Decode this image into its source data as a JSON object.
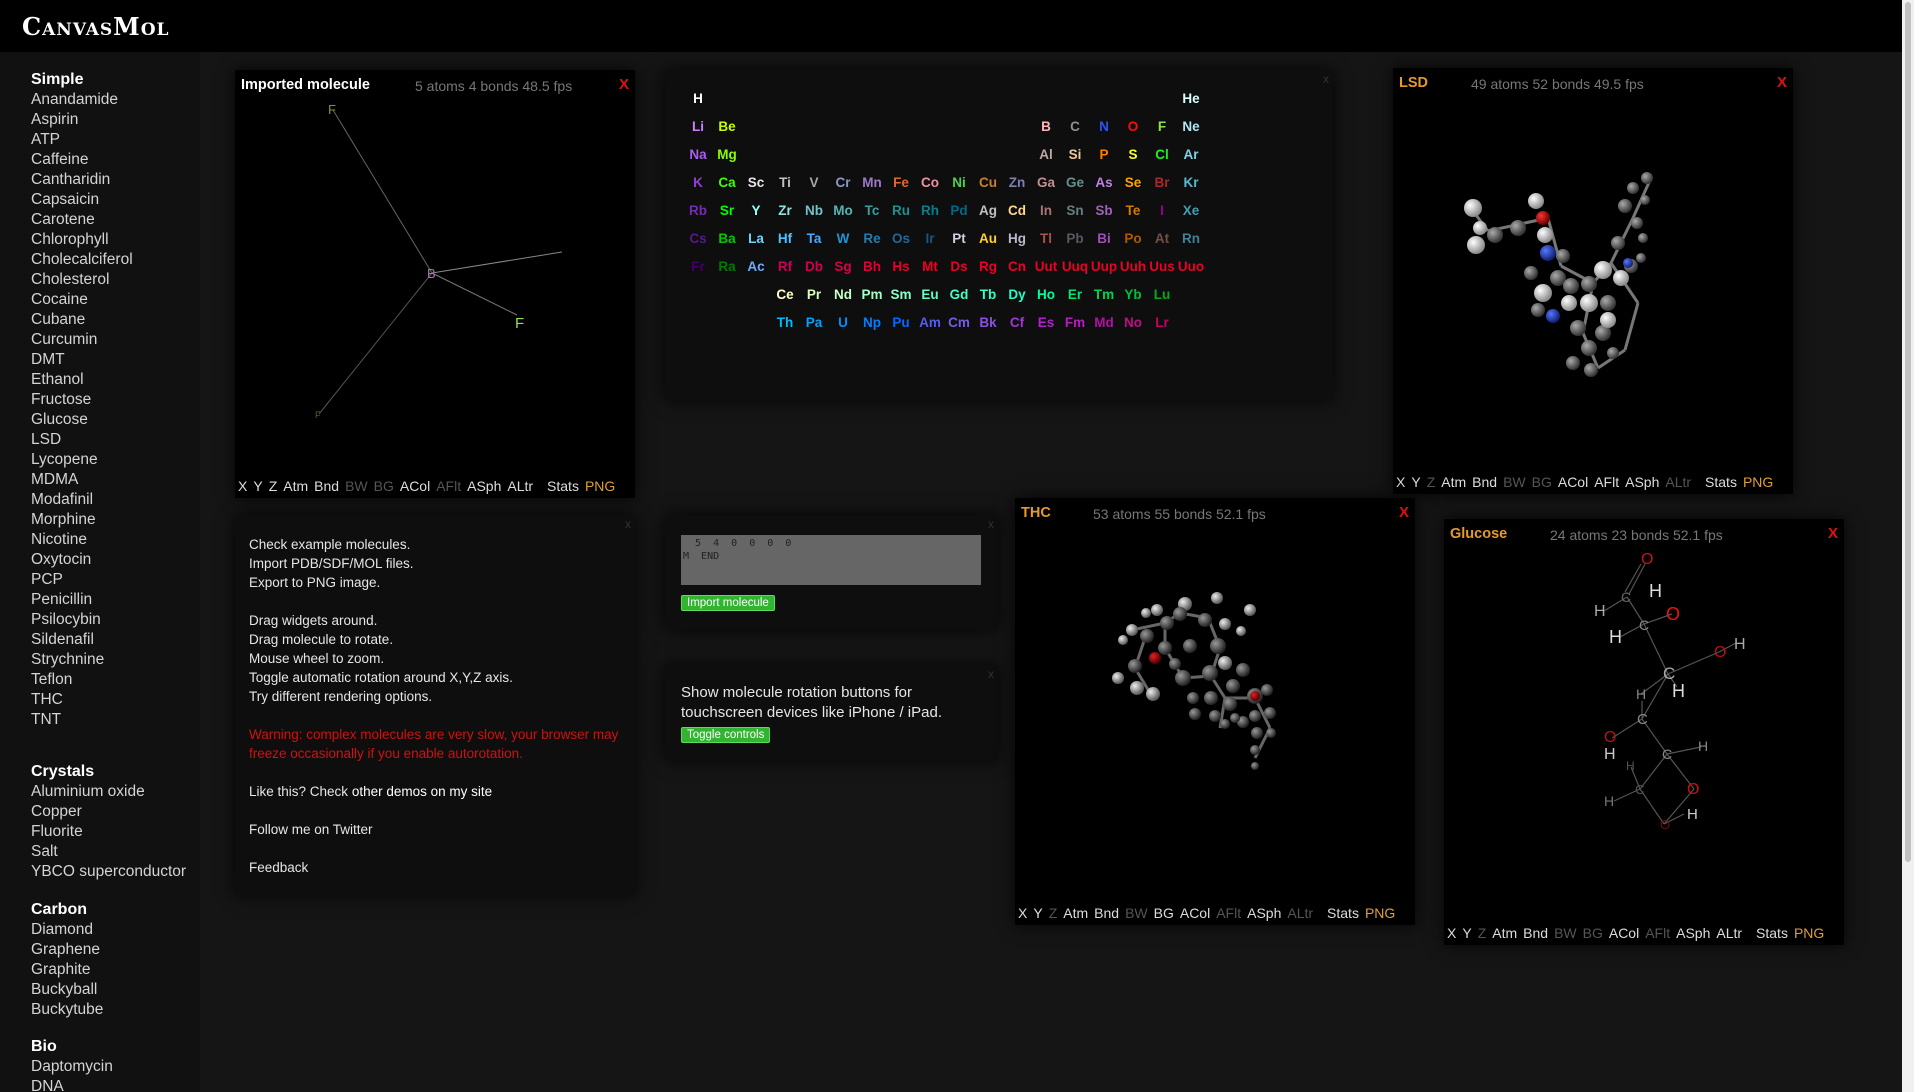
{
  "brand": "CanvasMol",
  "sidebar": [
    {
      "title": "Simple",
      "items": [
        "Anandamide",
        "Aspirin",
        "ATP",
        "Caffeine",
        "Cantharidin",
        "Capsaicin",
        "Carotene",
        "Chlorophyll",
        "Cholecalciferol",
        "Cholesterol",
        "Cocaine",
        "Cubane",
        "Curcumin",
        "DMT",
        "Ethanol",
        "Fructose",
        "Glucose",
        "LSD",
        "Lycopene",
        "MDMA",
        "Modafinil",
        "Morphine",
        "Nicotine",
        "Oxytocin",
        "PCP",
        "Penicillin",
        "Psilocybin",
        "Sildenafil",
        "Strychnine",
        "Teflon",
        "THC",
        "TNT"
      ]
    },
    {
      "title": "Crystals",
      "items": [
        "Aluminium oxide",
        "Copper",
        "Fluorite",
        "Salt",
        "YBCO superconductor"
      ]
    },
    {
      "title": "Carbon",
      "items": [
        "Diamond",
        "Graphene",
        "Graphite",
        "Buckyball",
        "Buckytube"
      ]
    },
    {
      "title": "Bio",
      "items": [
        "Daptomycin",
        "DNA"
      ]
    }
  ],
  "toolbar": {
    "x": "X",
    "y": "Y",
    "z": "Z",
    "atm": "Atm",
    "bnd": "Bnd",
    "bw": "BW",
    "bg": "BG",
    "acol": "ACol",
    "aflt": "AFlt",
    "asph": "ASph",
    "altr": "ALtr",
    "stats": "Stats",
    "png": "PNG"
  },
  "close": "X",
  "mini_close": "x",
  "widgets": {
    "imported": {
      "title": "Imported molecule",
      "title_color": "#ffffff",
      "stats": "5 atoms 4 bonds 48.5 fps"
    },
    "lsd": {
      "title": "LSD",
      "title_color": "#e79a2b",
      "stats": "49 atoms 52 bonds 49.5 fps"
    },
    "thc": {
      "title": "THC",
      "title_color": "#e79a2b",
      "stats": "53 atoms 55 bonds 52.1 fps"
    },
    "glucose": {
      "title": "Glucose",
      "title_color": "#e79a2b",
      "stats": "24 atoms 23 bonds 52.1 fps"
    }
  },
  "imported_atoms": {
    "f1": "F",
    "b": "B",
    "f2": "F",
    "f3": "F"
  },
  "glucose_labels": {
    "o": "O",
    "h": "H",
    "c": "C"
  },
  "info": {
    "l1": "Check example molecules.",
    "l2": "Import PDB/SDF/MOL files.",
    "l3": "Export to PNG image.",
    "l4": "Drag widgets around.",
    "l5": "Drag molecule to rotate.",
    "l6": "Mouse wheel to zoom.",
    "l7": "Toggle automatic rotation around X,Y,Z axis.",
    "l8": "Try different rendering options.",
    "warning": "Warning: complex molecules are very slow, your browser may freeze occasionally if you enable autorotation.",
    "like": "Like this? Check ",
    "like_link": "other demos on my site",
    "twitter": "Follow me on Twitter",
    "feedback": "Feedback"
  },
  "import": {
    "text": "  5  4  0  0  0  0\nM  END",
    "button": "Import molecule"
  },
  "touch": {
    "text": "Show molecule rotation buttons for touchscreen devices like iPhone / iPad.",
    "button": "Toggle controls"
  },
  "elements": [
    [
      "H",
      1,
      1,
      "#ffffff"
    ],
    [
      "He",
      1,
      18,
      "#d9ffff"
    ],
    [
      "Li",
      2,
      1,
      "#cc80ff"
    ],
    [
      "Be",
      2,
      2,
      "#c2ff00"
    ],
    [
      "B",
      2,
      13,
      "#ffb5b5"
    ],
    [
      "C",
      2,
      14,
      "#909090"
    ],
    [
      "N",
      2,
      15,
      "#3050f8"
    ],
    [
      "O",
      2,
      16,
      "#ff0d0d"
    ],
    [
      "F",
      2,
      17,
      "#90e050"
    ],
    [
      "Ne",
      2,
      18,
      "#b3e3f5"
    ],
    [
      "Na",
      3,
      1,
      "#ab5cf2"
    ],
    [
      "Mg",
      3,
      2,
      "#8aff00"
    ],
    [
      "Al",
      3,
      13,
      "#bfa6a6"
    ],
    [
      "Si",
      3,
      14,
      "#f0c8a0"
    ],
    [
      "P",
      3,
      15,
      "#ff8000"
    ],
    [
      "S",
      3,
      16,
      "#ffff30"
    ],
    [
      "Cl",
      3,
      17,
      "#1ff01f"
    ],
    [
      "Ar",
      3,
      18,
      "#80d1e3"
    ],
    [
      "K",
      4,
      1,
      "#8f40d4"
    ],
    [
      "Ca",
      4,
      2,
      "#3dff00"
    ],
    [
      "Sc",
      4,
      3,
      "#e6e6e6"
    ],
    [
      "Ti",
      4,
      4,
      "#bfc2c7"
    ],
    [
      "V",
      4,
      5,
      "#a6a6ab"
    ],
    [
      "Cr",
      4,
      6,
      "#8a99c7"
    ],
    [
      "Mn",
      4,
      7,
      "#9c7ac7"
    ],
    [
      "Fe",
      4,
      8,
      "#e06633"
    ],
    [
      "Co",
      4,
      9,
      "#f090a0"
    ],
    [
      "Ni",
      4,
      10,
      "#50d050"
    ],
    [
      "Cu",
      4,
      11,
      "#c88033"
    ],
    [
      "Zn",
      4,
      12,
      "#7d80b0"
    ],
    [
      "Ga",
      4,
      13,
      "#c28f8f"
    ],
    [
      "Ge",
      4,
      14,
      "#668f8f"
    ],
    [
      "As",
      4,
      15,
      "#bd80e3"
    ],
    [
      "Se",
      4,
      16,
      "#ffa100"
    ],
    [
      "Br",
      4,
      17,
      "#a62929"
    ],
    [
      "Kr",
      4,
      18,
      "#5cb8d1"
    ],
    [
      "Rb",
      5,
      1,
      "#702eb0"
    ],
    [
      "Sr",
      5,
      2,
      "#00ff00"
    ],
    [
      "Y",
      5,
      3,
      "#94ffff"
    ],
    [
      "Zr",
      5,
      4,
      "#94e0e0"
    ],
    [
      "Nb",
      5,
      5,
      "#73c2c9"
    ],
    [
      "Mo",
      5,
      6,
      "#54b5b5"
    ],
    [
      "Tc",
      5,
      7,
      "#3b9e9e"
    ],
    [
      "Ru",
      5,
      8,
      "#248f8f"
    ],
    [
      "Rh",
      5,
      9,
      "#0a7d8c"
    ],
    [
      "Pd",
      5,
      10,
      "#006985"
    ],
    [
      "Ag",
      5,
      11,
      "#c0c0c0"
    ],
    [
      "Cd",
      5,
      12,
      "#ffd98f"
    ],
    [
      "In",
      5,
      13,
      "#a67573"
    ],
    [
      "Sn",
      5,
      14,
      "#668080"
    ],
    [
      "Sb",
      5,
      15,
      "#9e63b5"
    ],
    [
      "Te",
      5,
      16,
      "#d47a00"
    ],
    [
      "I",
      5,
      17,
      "#940094"
    ],
    [
      "Xe",
      5,
      18,
      "#429eb0"
    ],
    [
      "Cs",
      6,
      1,
      "#57178f"
    ],
    [
      "Ba",
      6,
      2,
      "#00c900"
    ],
    [
      "La",
      6,
      3,
      "#70d4ff"
    ],
    [
      "Hf",
      6,
      4,
      "#4dc2ff"
    ],
    [
      "Ta",
      6,
      5,
      "#4da6ff"
    ],
    [
      "W",
      6,
      6,
      "#2194d6"
    ],
    [
      "Re",
      6,
      7,
      "#267dab"
    ],
    [
      "Os",
      6,
      8,
      "#266696"
    ],
    [
      "Ir",
      6,
      9,
      "#175487"
    ],
    [
      "Pt",
      6,
      10,
      "#d0d0e0"
    ],
    [
      "Au",
      6,
      11,
      "#ffd123"
    ],
    [
      "Hg",
      6,
      12,
      "#b8b8d0"
    ],
    [
      "Tl",
      6,
      13,
      "#a6544d"
    ],
    [
      "Pb",
      6,
      14,
      "#575961"
    ],
    [
      "Bi",
      6,
      15,
      "#9e4fb5"
    ],
    [
      "Po",
      6,
      16,
      "#ab5c00"
    ],
    [
      "At",
      6,
      17,
      "#754f45"
    ],
    [
      "Rn",
      6,
      18,
      "#428296"
    ],
    [
      "Fr",
      7,
      1,
      "#420066"
    ],
    [
      "Ra",
      7,
      2,
      "#007d00"
    ],
    [
      "Ac",
      7,
      3,
      "#70abfa"
    ],
    [
      "Rf",
      7,
      4,
      "#cc0059"
    ],
    [
      "Db",
      7,
      5,
      "#d1004f"
    ],
    [
      "Sg",
      7,
      6,
      "#d90045"
    ],
    [
      "Bh",
      7,
      7,
      "#e00038"
    ],
    [
      "Hs",
      7,
      8,
      "#e6002e"
    ],
    [
      "Mt",
      7,
      9,
      "#eb0026"
    ],
    [
      "Ds",
      7,
      10,
      "#eb0026"
    ],
    [
      "Rg",
      7,
      11,
      "#eb0026"
    ],
    [
      "Cn",
      7,
      12,
      "#eb0026"
    ],
    [
      "Uut",
      7,
      13,
      "#eb0026"
    ],
    [
      "Uuq",
      7,
      14,
      "#eb0026"
    ],
    [
      "Uup",
      7,
      15,
      "#eb0026"
    ],
    [
      "Uuh",
      7,
      16,
      "#eb0026"
    ],
    [
      "Uus",
      7,
      17,
      "#eb0026"
    ],
    [
      "Uuo",
      7,
      18,
      "#eb0026"
    ],
    [
      "Ce",
      8,
      4,
      "#ffffc7"
    ],
    [
      "Pr",
      8,
      5,
      "#d9ffc7"
    ],
    [
      "Nd",
      8,
      6,
      "#c7ffc7"
    ],
    [
      "Pm",
      8,
      7,
      "#a3ffc7"
    ],
    [
      "Sm",
      8,
      8,
      "#8fffc7"
    ],
    [
      "Eu",
      8,
      9,
      "#61ffc7"
    ],
    [
      "Gd",
      8,
      10,
      "#45ffc7"
    ],
    [
      "Tb",
      8,
      11,
      "#30ffc7"
    ],
    [
      "Dy",
      8,
      12,
      "#1fffc7"
    ],
    [
      "Ho",
      8,
      13,
      "#00ff9c"
    ],
    [
      "Er",
      8,
      14,
      "#00e675"
    ],
    [
      "Tm",
      8,
      15,
      "#00d452"
    ],
    [
      "Yb",
      8,
      16,
      "#00bf38"
    ],
    [
      "Lu",
      8,
      17,
      "#00ab24"
    ],
    [
      "Th",
      9,
      4,
      "#00baff"
    ],
    [
      "Pa",
      9,
      5,
      "#00a1ff"
    ],
    [
      "U",
      9,
      6,
      "#008fff"
    ],
    [
      "Np",
      9,
      7,
      "#0080ff"
    ],
    [
      "Pu",
      9,
      8,
      "#006bff"
    ],
    [
      "Am",
      9,
      9,
      "#545cf2"
    ],
    [
      "Cm",
      9,
      10,
      "#785ce3"
    ],
    [
      "Bk",
      9,
      11,
      "#8a4fe3"
    ],
    [
      "Cf",
      9,
      12,
      "#a136d4"
    ],
    [
      "Es",
      9,
      13,
      "#b31fd4"
    ],
    [
      "Fm",
      9,
      14,
      "#b31fba"
    ],
    [
      "Md",
      9,
      15,
      "#b30da6"
    ],
    [
      "No",
      9,
      16,
      "#bd0d87"
    ],
    [
      "Lr",
      9,
      17,
      "#c70066"
    ]
  ]
}
